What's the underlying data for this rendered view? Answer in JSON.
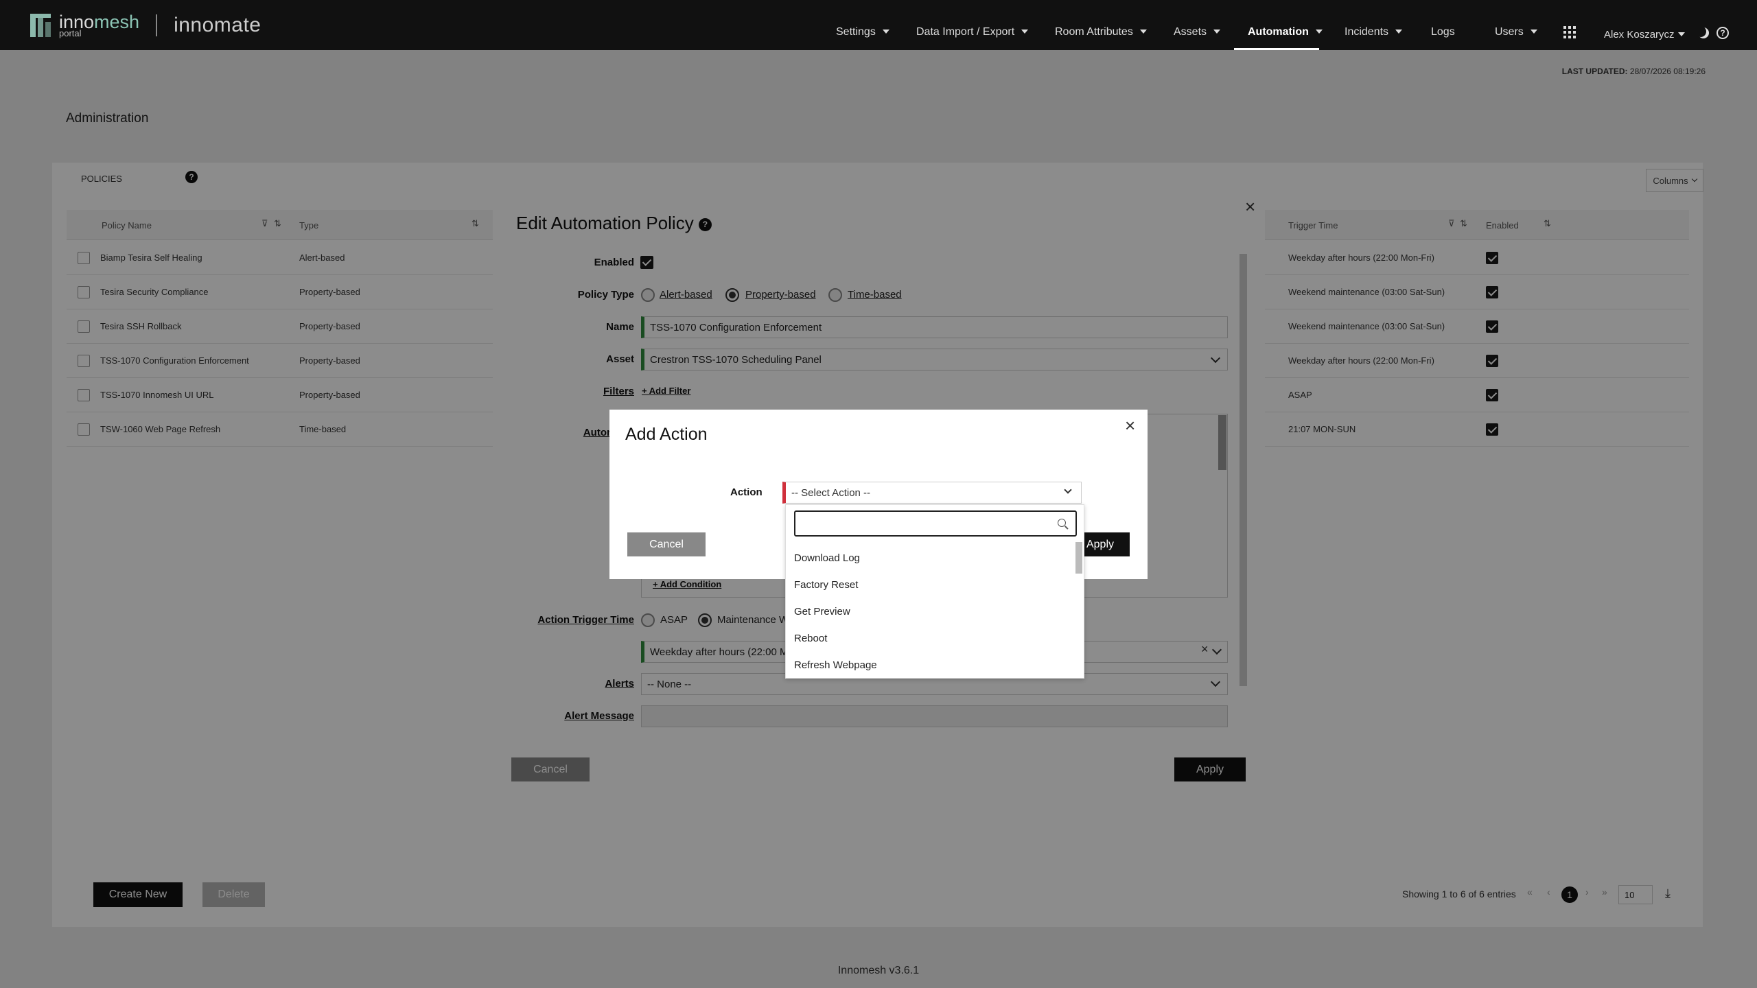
{
  "nav": {
    "logo_main_a": "inno",
    "logo_main_b": "mesh",
    "logo_sub": "portal",
    "brand": "innomate",
    "items": [
      {
        "label": "Settings"
      },
      {
        "label": "Data Import / Export"
      },
      {
        "label": "Room Attributes"
      },
      {
        "label": "Assets"
      },
      {
        "label": "Automation"
      },
      {
        "label": "Incidents"
      },
      {
        "label": "Logs"
      },
      {
        "label": "Users"
      }
    ],
    "user": "Alex Koszarycz",
    "apps_icon": "grid-icon",
    "theme_icon": "moon-icon",
    "help_icon": "help-icon"
  },
  "page": {
    "last_updated_label": "LAST UPDATED:",
    "last_updated_value": "28/07/2026 08:19:26",
    "title": "Administration",
    "tab": "POLICIES",
    "columns_btn": "Columns"
  },
  "table": {
    "headers": {
      "policy_name": "Policy Name",
      "type": "Type",
      "trigger_time": "Trigger Time",
      "enabled": "Enabled"
    },
    "rows": [
      {
        "name": "Biamp Tesira Self Healing",
        "type": "Alert-based",
        "trigger": "Weekday after hours (22:00 Mon-Fri)",
        "enabled": true
      },
      {
        "name": "Tesira Security Compliance",
        "type": "Property-based",
        "trigger": "Weekend maintenance (03:00 Sat-Sun)",
        "enabled": true
      },
      {
        "name": "Tesira SSH Rollback",
        "type": "Property-based",
        "trigger": "Weekend maintenance (03:00 Sat-Sun)",
        "enabled": true
      },
      {
        "name": "TSS-1070 Configuration Enforcement",
        "type": "Property-based",
        "trigger": "Weekday after hours (22:00 Mon-Fri)",
        "enabled": true
      },
      {
        "name": "TSS-1070 Innomesh UI URL",
        "type": "Property-based",
        "trigger": "ASAP",
        "enabled": true
      },
      {
        "name": "TSW-1060 Web Page Refresh",
        "type": "Time-based",
        "trigger": "21:07 MON-SUN",
        "enabled": true
      }
    ],
    "create_new": "Create New",
    "delete": "Delete",
    "showing": "Showing 1 to 6 of 6 entries",
    "current_page": "1",
    "page_size": "10"
  },
  "footer": "Innomesh v3.6.1",
  "edit_modal": {
    "title": "Edit Automation Policy",
    "enabled_label": "Enabled",
    "enabled": true,
    "policy_type_label": "Policy Type",
    "policy_types": [
      "Alert-based",
      "Property-based",
      "Time-based"
    ],
    "policy_type_selected": "Property-based",
    "name_label": "Name",
    "name_value": "TSS-1070 Configuration Enforcement",
    "asset_label": "Asset",
    "asset_value": "Crestron TSS-1070 Scheduling Panel",
    "filters_label": "Filters",
    "add_filter": "+ Add Filter",
    "automation_label": "Automatio",
    "add_condition": "+ Add Condition",
    "trigger_label": "Action Trigger Time",
    "trigger_asap": "ASAP",
    "trigger_maint": "Maintenance W",
    "trigger_value": "Weekday after hours (22:00 M",
    "alerts_label": "Alerts",
    "alerts_value": "-- None --",
    "alert_msg_label": "Alert Message",
    "cancel": "Cancel",
    "apply": "Apply"
  },
  "add_action": {
    "title": "Add Action",
    "action_label": "Action",
    "placeholder": "-- Select Action --",
    "cancel": "Cancel",
    "apply": "Apply",
    "search_value": "",
    "options": [
      "Download Log",
      "Factory Reset",
      "Get Preview",
      "Reboot",
      "Refresh Webpage"
    ]
  }
}
